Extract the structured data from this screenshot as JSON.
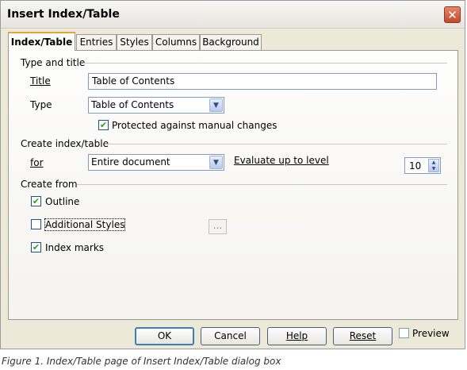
{
  "window": {
    "title": "Insert Index/Table",
    "close_glyph": "✕"
  },
  "tabs": [
    {
      "label": "Index/Table",
      "active": true
    },
    {
      "label": "Entries",
      "active": false
    },
    {
      "label": "Styles",
      "active": false
    },
    {
      "label": "Columns",
      "active": false
    },
    {
      "label": "Background",
      "active": false
    }
  ],
  "type_and_title": {
    "heading": "Type and title",
    "title_label": "Title",
    "title_value": "Table of Contents",
    "type_label": "Type",
    "type_value": "Table of Contents",
    "protected_label": "Protected against manual changes",
    "protected_checked": true
  },
  "create_index": {
    "heading": "Create index/table",
    "for_label": "for",
    "for_value": "Entire document",
    "evaluate_label": "Evaluate up to level",
    "level_value": "10"
  },
  "create_from": {
    "heading": "Create from",
    "outline_label": "Outline",
    "outline_checked": true,
    "additional_styles_label": "Additional Styles",
    "additional_styles_checked": false,
    "ellipsis_label": "...",
    "index_marks_label": "Index marks",
    "index_marks_checked": true
  },
  "buttons": {
    "ok": "OK",
    "cancel": "Cancel",
    "help": "Help",
    "reset": "Reset",
    "preview_label": "Preview",
    "preview_checked": false
  },
  "caption": "Figure 1. Index/Table page of Insert Index/Table dialog box",
  "icons": {
    "check": "✔",
    "dropdown": "▼",
    "spin_up": "▲",
    "spin_down": "▼"
  }
}
